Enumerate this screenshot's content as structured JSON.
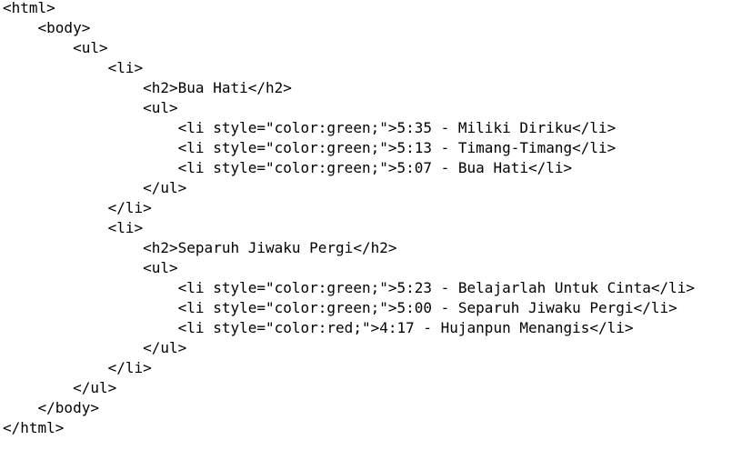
{
  "code": {
    "lines": [
      "<html>",
      "    <body>",
      "        <ul>",
      "            <li>",
      "                <h2>Bua Hati</h2>",
      "                <ul>",
      "                    <li style=\"color:green;\">5:35 - Miliki Diriku</li>",
      "                    <li style=\"color:green;\">5:13 - Timang-Timang</li>",
      "                    <li style=\"color:green;\">5:07 - Bua Hati</li>",
      "                </ul>",
      "            </li>",
      "            <li>",
      "                <h2>Separuh Jiwaku Pergi</h2>",
      "                <ul>",
      "                    <li style=\"color:green;\">5:23 - Belajarlah Untuk Cinta</li>",
      "                    <li style=\"color:green;\">5:00 - Separuh Jiwaku Pergi</li>",
      "                    <li style=\"color:red;\">4:17 - Hujanpun Menangis</li>",
      "                </ul>",
      "            </li>",
      "        </ul>",
      "    </body>",
      "</html>"
    ]
  }
}
